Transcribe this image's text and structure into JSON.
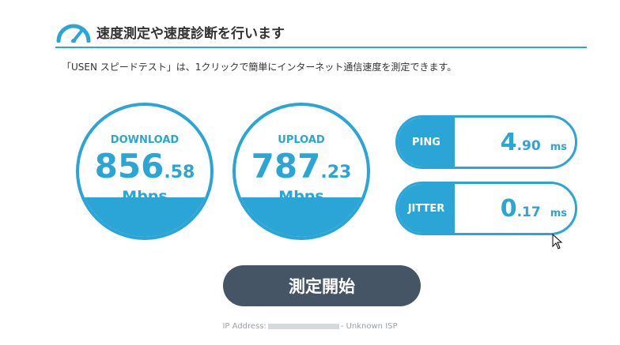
{
  "header": {
    "title": "速度測定や速度診断を行います",
    "accent_color": "#2aa5d6",
    "icon": "speedometer-icon"
  },
  "description": "「USEN スピードテスト」は、1クリックで簡単にインターネット通信速度を測定できます。",
  "download": {
    "label": "DOWNLOAD",
    "int": "856",
    "dec": ".58",
    "unit": "Mbps"
  },
  "upload": {
    "label": "UPLOAD",
    "int": "787",
    "dec": ".23",
    "unit": "Mbps"
  },
  "ping": {
    "label": "PING",
    "int": "4",
    "dec": ".90",
    "unit": "ms"
  },
  "jitter": {
    "label": "JITTER",
    "int": "0",
    "dec": ".17",
    "unit": "ms"
  },
  "start_button": {
    "label": "測定開始",
    "color": "#465565"
  },
  "footer": {
    "ip_label": "IP Address:",
    "isp": "- Unknown ISP"
  }
}
